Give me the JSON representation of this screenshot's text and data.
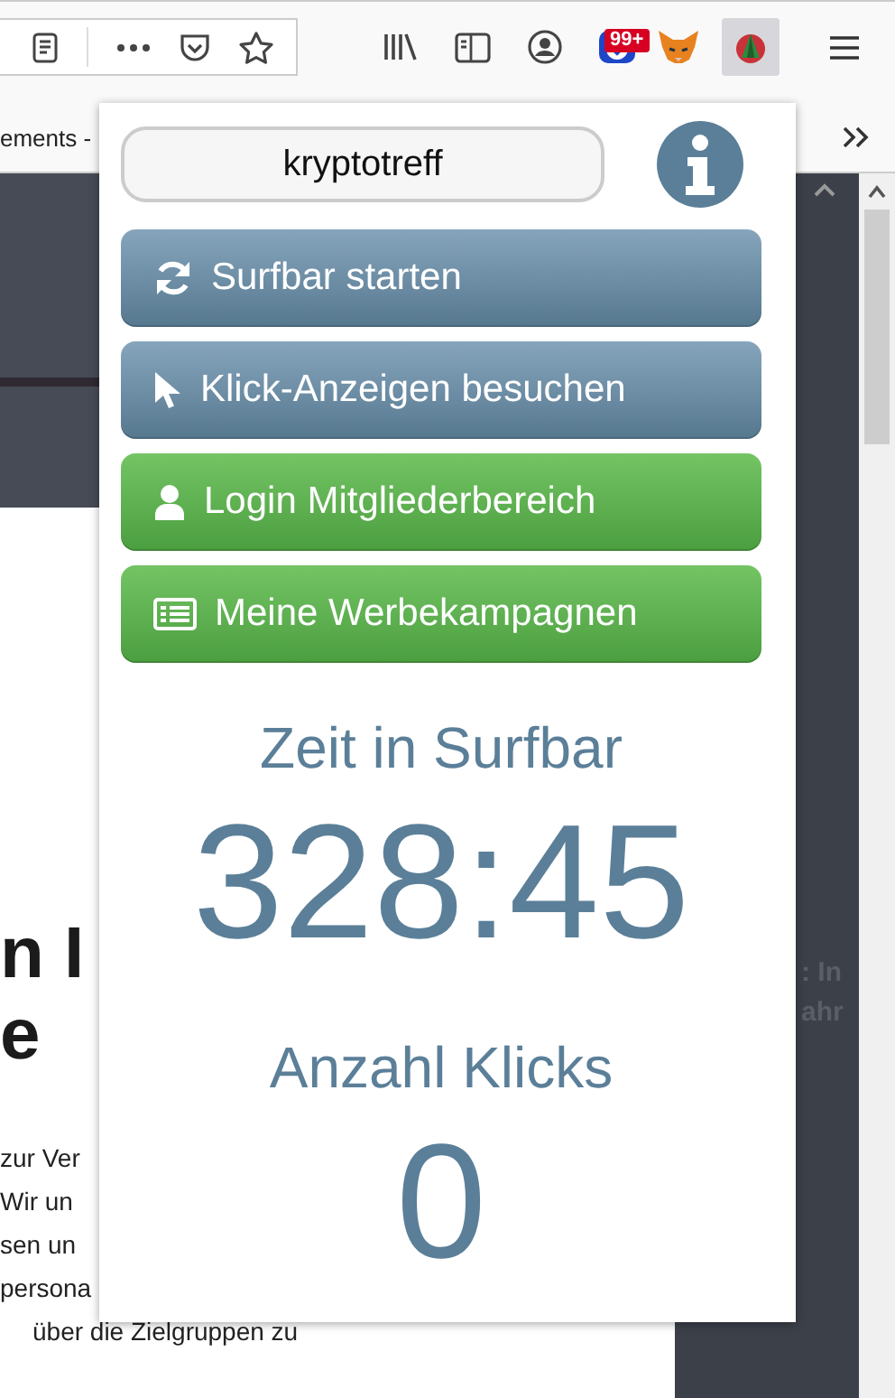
{
  "toolbar": {
    "badge": "99+"
  },
  "bookmarks_bar": {
    "item": "ements -"
  },
  "page": {
    "headline_lines": [
      "n I",
      "e"
    ],
    "paragraph_lines": [
      "zur Ver",
      "Wir un",
      "sen un",
      "persona",
      "über die Zielgruppen zu"
    ],
    "sidebar_lines": [
      ": In",
      "ahr"
    ]
  },
  "popup": {
    "search": {
      "value": "kryptotreff"
    },
    "buttons": [
      {
        "label": "Surfbar starten",
        "kind": "primary"
      },
      {
        "label": "Klick-Anzeigen besuchen",
        "kind": "primary"
      },
      {
        "label": "Login Mitgliederbereich",
        "kind": "success"
      },
      {
        "label": "Meine Werbekampagnen",
        "kind": "success"
      }
    ],
    "stats": [
      {
        "label": "Zeit in Surfbar",
        "value": "328:45"
      },
      {
        "label": "Anzahl Klicks",
        "value": "0"
      }
    ]
  }
}
